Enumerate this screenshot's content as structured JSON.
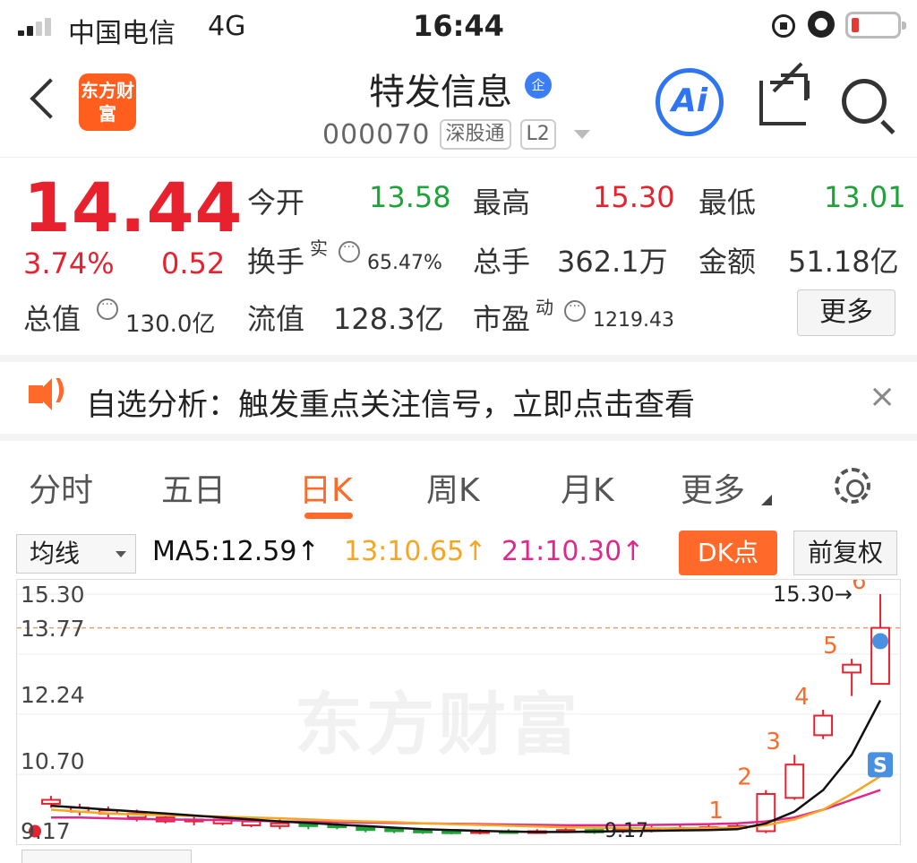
{
  "status": {
    "carrier": "中国电信",
    "network": "4G",
    "time": "16:44"
  },
  "header": {
    "logo_text": "东方财富",
    "name": "特发信息",
    "corp_badge": "企",
    "code": "000070",
    "tags": [
      "深股通",
      "L2"
    ],
    "ai_label": "Ai"
  },
  "quote": {
    "price": "14.44",
    "change_pct": "3.74%",
    "change": "0.52",
    "fields": {
      "open_label": "今开",
      "open": "13.58",
      "high_label": "最高",
      "high": "15.30",
      "low_label": "最低",
      "low": "13.01",
      "turnover_label": "换手",
      "turnover_sup": "实",
      "turnover": "65.47%",
      "volume_label": "总手",
      "volume": "362.1万",
      "amount_label": "金额",
      "amount": "51.18亿",
      "mktcap_label": "总值",
      "mktcap": "130.0亿",
      "float_label": "流值",
      "float": "128.3亿",
      "pe_label": "市盈",
      "pe_sup": "动",
      "pe": "1219.43"
    },
    "more": "更多"
  },
  "notice": {
    "text": "自选分析：触发重点关注信号，立即点击查看",
    "close": "×"
  },
  "tabs": [
    {
      "label": "分时"
    },
    {
      "label": "五日"
    },
    {
      "label": "日K"
    },
    {
      "label": "周K"
    },
    {
      "label": "月K"
    },
    {
      "label": "更多"
    }
  ],
  "ma_bar": {
    "select": "均线",
    "ma5": "MA5:12.59↑",
    "ma13": "13:10.65↑",
    "ma21": "21:10.30↑",
    "dk": "DK点",
    "adjust": "前复权"
  },
  "colors": {
    "up": "#e8212e",
    "down": "#1ea23a",
    "ma5": "#111111",
    "ma13": "#f5a623",
    "ma21": "#e0288c",
    "accent": "#ff6a2b"
  },
  "chart_data": {
    "type": "candlestick",
    "y_tick_labels": [
      "15.30",
      "13.77",
      "12.24",
      "10.70",
      "9.17"
    ],
    "ylim": [
      9.17,
      15.3
    ],
    "peak_label": "15.30→",
    "low_label": "9.17",
    "signal_marks": [
      "1",
      "2",
      "3",
      "4",
      "5",
      "6"
    ],
    "sell_mark": "S",
    "watermark": "东方财富",
    "candles": [
      {
        "o": 9.95,
        "c": 10.05,
        "h": 10.15,
        "l": 9.85
      },
      {
        "o": 9.75,
        "c": 9.85,
        "h": 9.95,
        "l": 9.65
      },
      {
        "o": 9.7,
        "c": 9.78,
        "h": 9.88,
        "l": 9.6
      },
      {
        "o": 9.6,
        "c": 9.7,
        "h": 9.8,
        "l": 9.5
      },
      {
        "o": 9.5,
        "c": 9.6,
        "h": 9.7,
        "l": 9.45
      },
      {
        "o": 9.5,
        "c": 9.55,
        "h": 9.65,
        "l": 9.4
      },
      {
        "o": 9.45,
        "c": 9.55,
        "h": 9.6,
        "l": 9.4
      },
      {
        "o": 9.4,
        "c": 9.5,
        "h": 9.55,
        "l": 9.35
      },
      {
        "o": 9.38,
        "c": 9.45,
        "h": 9.55,
        "l": 9.3
      },
      {
        "o": 9.45,
        "c": 9.38,
        "h": 9.5,
        "l": 9.3
      },
      {
        "o": 9.4,
        "c": 9.35,
        "h": 9.5,
        "l": 9.3
      },
      {
        "o": 9.35,
        "c": 9.28,
        "h": 9.4,
        "l": 9.22
      },
      {
        "o": 9.3,
        "c": 9.25,
        "h": 9.35,
        "l": 9.2
      },
      {
        "o": 9.28,
        "c": 9.22,
        "h": 9.32,
        "l": 9.18
      },
      {
        "o": 9.25,
        "c": 9.2,
        "h": 9.3,
        "l": 9.17
      },
      {
        "o": 9.22,
        "c": 9.25,
        "h": 9.3,
        "l": 9.17
      },
      {
        "o": 9.25,
        "c": 9.22,
        "h": 9.3,
        "l": 9.18
      },
      {
        "o": 9.22,
        "c": 9.25,
        "h": 9.3,
        "l": 9.18
      },
      {
        "o": 9.25,
        "c": 9.28,
        "h": 9.35,
        "l": 9.2
      },
      {
        "o": 9.28,
        "c": 9.22,
        "h": 9.32,
        "l": 9.18
      },
      {
        "o": 9.25,
        "c": 9.3,
        "h": 9.35,
        "l": 9.2
      },
      {
        "o": 9.28,
        "c": 9.32,
        "h": 9.38,
        "l": 9.22
      },
      {
        "o": 9.3,
        "c": 9.33,
        "h": 9.4,
        "l": 9.25
      },
      {
        "o": 9.32,
        "c": 9.35,
        "h": 9.45,
        "l": 9.28
      },
      {
        "o": 9.35,
        "c": 9.38,
        "h": 9.45,
        "l": 9.3
      },
      {
        "o": 9.25,
        "c": 10.2,
        "h": 10.3,
        "l": 9.2
      },
      {
        "o": 10.1,
        "c": 10.95,
        "h": 11.2,
        "l": 10.05
      },
      {
        "o": 11.7,
        "c": 12.2,
        "h": 12.35,
        "l": 11.6
      },
      {
        "o": 13.3,
        "c": 13.5,
        "h": 13.65,
        "l": 12.7
      },
      {
        "o": 13.01,
        "c": 14.44,
        "h": 15.3,
        "l": 13.01
      }
    ],
    "ma5": [
      9.9,
      9.85,
      9.8,
      9.75,
      9.7,
      9.65,
      9.6,
      9.55,
      9.5,
      9.46,
      9.42,
      9.38,
      9.34,
      9.3,
      9.28,
      9.26,
      9.24,
      9.23,
      9.23,
      9.24,
      9.25,
      9.26,
      9.27,
      9.28,
      9.3,
      9.45,
      9.75,
      10.3,
      11.2,
      12.59
    ],
    "ma13": [
      9.8,
      9.75,
      9.7,
      9.68,
      9.66,
      9.64,
      9.62,
      9.6,
      9.58,
      9.55,
      9.52,
      9.5,
      9.48,
      9.45,
      9.43,
      9.41,
      9.39,
      9.37,
      9.35,
      9.34,
      9.33,
      9.32,
      9.32,
      9.33,
      9.34,
      9.4,
      9.55,
      9.8,
      10.2,
      10.65
    ],
    "ma21": [
      9.6,
      9.6,
      9.58,
      9.56,
      9.55,
      9.54,
      9.53,
      9.52,
      9.5,
      9.49,
      9.48,
      9.47,
      9.46,
      9.45,
      9.44,
      9.43,
      9.42,
      9.41,
      9.4,
      9.4,
      9.4,
      9.41,
      9.42,
      9.43,
      9.45,
      9.5,
      9.6,
      9.8,
      10.05,
      10.3
    ]
  }
}
